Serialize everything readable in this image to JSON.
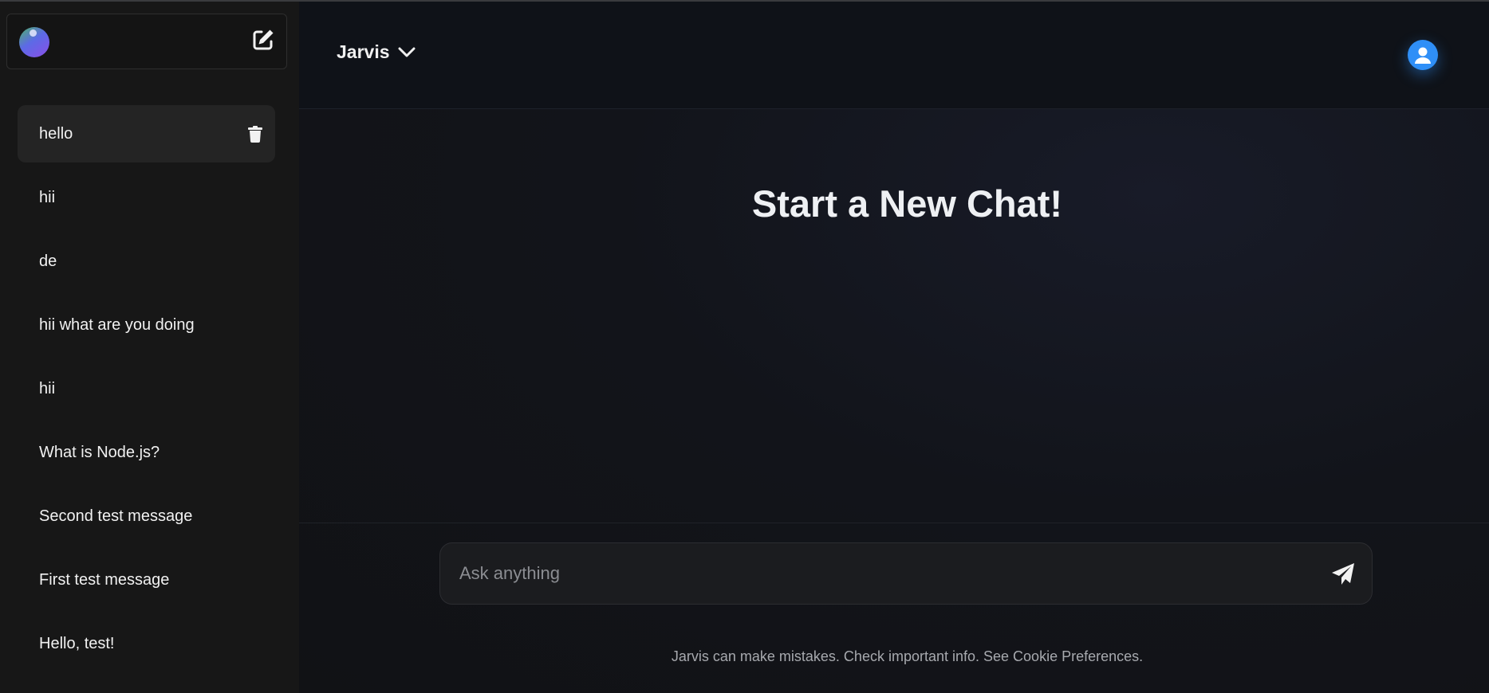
{
  "sidebar": {
    "items": [
      {
        "label": "hello"
      },
      {
        "label": "hii"
      },
      {
        "label": "de"
      },
      {
        "label": "hii what are you doing"
      },
      {
        "label": "hii"
      },
      {
        "label": "What is Node.js?"
      },
      {
        "label": "Second test message"
      },
      {
        "label": "First test message"
      },
      {
        "label": "Hello, test!"
      }
    ],
    "active_index": 0
  },
  "header": {
    "model_name": "Jarvis"
  },
  "main": {
    "heading": "Start a New Chat!"
  },
  "composer": {
    "placeholder": "Ask anything",
    "value": ""
  },
  "footer": {
    "note": "Jarvis can make mistakes. Check important info. See Cookie Preferences."
  },
  "icons": {
    "new_chat": "edit-icon",
    "delete": "trash-icon",
    "model_dropdown": "chevron-down-icon",
    "user": "user-icon",
    "send": "paper-plane-icon"
  },
  "colors": {
    "accent": "#2f8ff7",
    "sidebar_bg": "#171717",
    "main_bg": "#111215"
  }
}
